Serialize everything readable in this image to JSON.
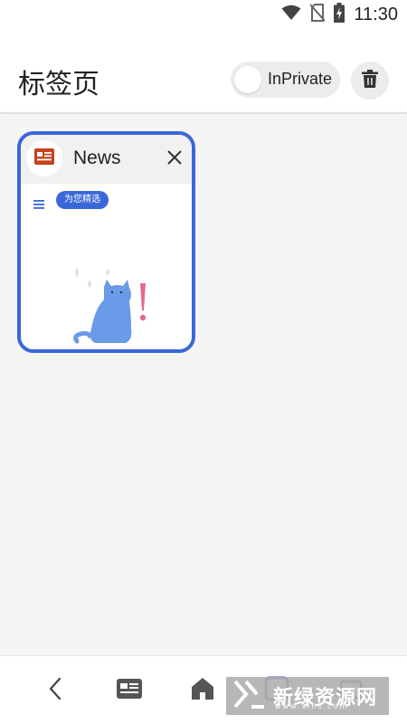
{
  "status_bar": {
    "time": "11:30",
    "icons": [
      "wifi-icon",
      "no-sim-icon",
      "battery-charging-icon"
    ]
  },
  "header": {
    "title": "标签页",
    "inprivate_label": "InPrivate",
    "inprivate_enabled": false,
    "trash_icon": "trash-icon"
  },
  "tabs": [
    {
      "title": "News",
      "favicon": "news-icon",
      "preview": {
        "pill_label": "为您精选",
        "menu_icon": "hamburger-icon",
        "illustration": "cat-illustration"
      }
    }
  ],
  "fab": {
    "icon": "plus-icon"
  },
  "bottom_nav": {
    "items": [
      "back-icon",
      "news-icon",
      "home-icon",
      "tabs-icon",
      "share-icon"
    ]
  },
  "watermark": {
    "text": "新绿资源网",
    "sub": "www.xlhs.com"
  },
  "colors": {
    "accent": "#3a67d8",
    "background": "#f5f5f6",
    "news_icon": "#c8401e",
    "cat": "#6a9be8",
    "exclaim": "#e06a8e"
  }
}
